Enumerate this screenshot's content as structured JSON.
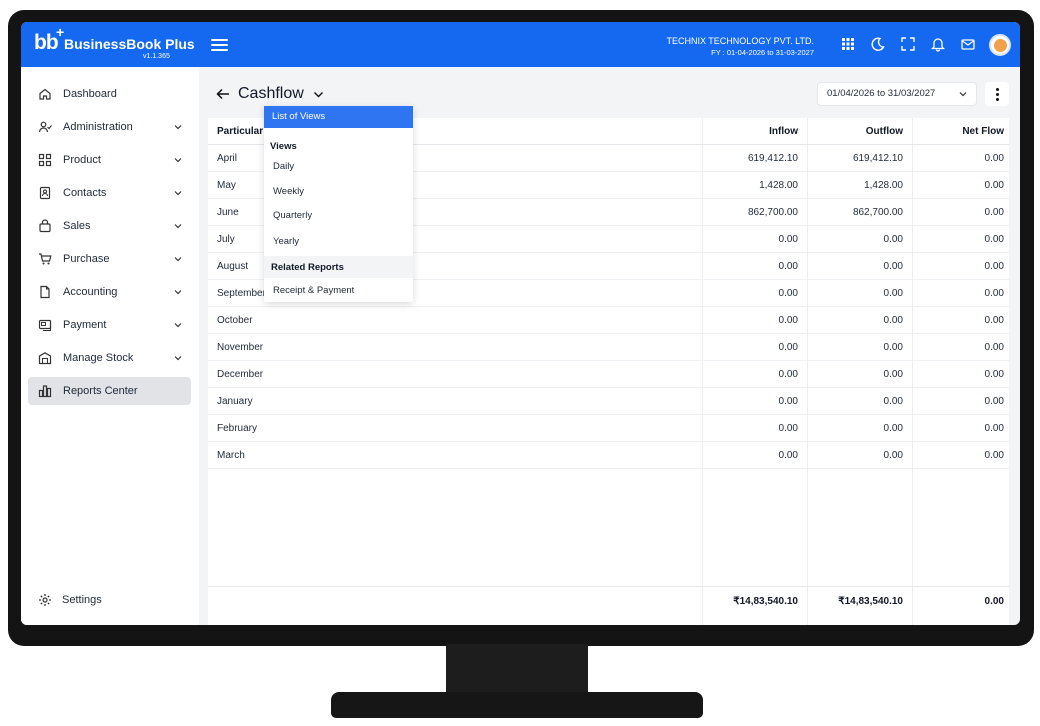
{
  "app": {
    "logo_mark": "bb",
    "logo_plus": "+",
    "name": "BusinessBook Plus",
    "version": "v1.1.365",
    "brand_color": "#1469f0"
  },
  "header": {
    "company_name": "TECHNIX TECHNOLOGY PVT. LTD.",
    "fy": "FY : 01-04-2026 to 31-03-2027",
    "icons": [
      "apps-grid-icon",
      "moon-icon",
      "fullscreen-icon",
      "bell-icon",
      "mail-icon",
      "user-avatar"
    ]
  },
  "sidebar": {
    "items": [
      {
        "label": "Dashboard",
        "icon": "home-icon",
        "has_children": false
      },
      {
        "label": "Administration",
        "icon": "users-icon",
        "has_children": true
      },
      {
        "label": "Product",
        "icon": "grid-icon",
        "has_children": true
      },
      {
        "label": "Contacts",
        "icon": "contact-book-icon",
        "has_children": true
      },
      {
        "label": "Sales",
        "icon": "bag-icon",
        "has_children": true
      },
      {
        "label": "Purchase",
        "icon": "cart-icon",
        "has_children": true
      },
      {
        "label": "Accounting",
        "icon": "document-icon",
        "has_children": true
      },
      {
        "label": "Payment",
        "icon": "payment-icon",
        "has_children": true
      },
      {
        "label": "Manage Stock",
        "icon": "warehouse-icon",
        "has_children": true
      },
      {
        "label": "Reports Center",
        "icon": "bar-chart-icon",
        "has_children": false,
        "active": true
      }
    ],
    "settings_label": "Settings"
  },
  "page": {
    "title": "Cashflow",
    "date_range": "01/04/2026 to 31/03/2027"
  },
  "table": {
    "headers": {
      "particular": "Particular",
      "inflow": "Inflow",
      "outflow": "Outflow",
      "net_flow": "Net Flow"
    },
    "rows": [
      {
        "particular": "April",
        "inflow": "619,412.10",
        "outflow": "619,412.10",
        "net_flow": "0.00"
      },
      {
        "particular": "May",
        "inflow": "1,428.00",
        "outflow": "1,428.00",
        "net_flow": "0.00"
      },
      {
        "particular": "June",
        "inflow": "862,700.00",
        "outflow": "862,700.00",
        "net_flow": "0.00"
      },
      {
        "particular": "July",
        "inflow": "0.00",
        "outflow": "0.00",
        "net_flow": "0.00"
      },
      {
        "particular": "August",
        "inflow": "0.00",
        "outflow": "0.00",
        "net_flow": "0.00"
      },
      {
        "particular": "September",
        "inflow": "0.00",
        "outflow": "0.00",
        "net_flow": "0.00"
      },
      {
        "particular": "October",
        "inflow": "0.00",
        "outflow": "0.00",
        "net_flow": "0.00"
      },
      {
        "particular": "November",
        "inflow": "0.00",
        "outflow": "0.00",
        "net_flow": "0.00"
      },
      {
        "particular": "December",
        "inflow": "0.00",
        "outflow": "0.00",
        "net_flow": "0.00"
      },
      {
        "particular": "January",
        "inflow": "0.00",
        "outflow": "0.00",
        "net_flow": "0.00"
      },
      {
        "particular": "February",
        "inflow": "0.00",
        "outflow": "0.00",
        "net_flow": "0.00"
      },
      {
        "particular": "March",
        "inflow": "0.00",
        "outflow": "0.00",
        "net_flow": "0.00"
      }
    ],
    "totals": {
      "inflow": "₹14,83,540.10",
      "outflow": "₹14,83,540.10",
      "net_flow": "0.00"
    }
  },
  "views_menu": {
    "top_label": "List of Views",
    "views_heading": "Views",
    "views": [
      "Daily",
      "Weekly",
      "Quarterly",
      "Yearly"
    ],
    "related_heading": "Related Reports",
    "related": [
      "Receipt & Payment"
    ],
    "highlight_color": "#2f74f0"
  }
}
